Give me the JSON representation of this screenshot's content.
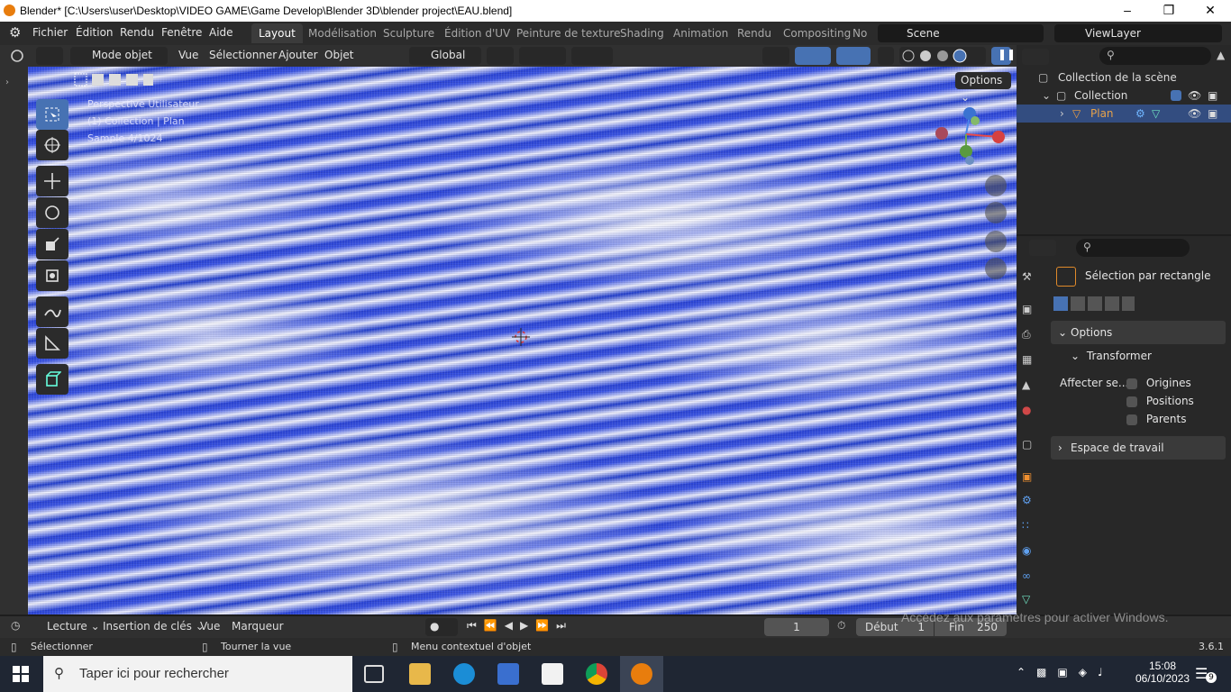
{
  "window": {
    "title": "Blender* [C:\\Users\\user\\Desktop\\VIDEO GAME\\Game Develop\\Blender 3D\\blender project\\EAU.blend]"
  },
  "menubar": {
    "menus": [
      "Fichier",
      "Édition",
      "Rendu",
      "Fenêtre",
      "Aide"
    ],
    "workspaces": [
      "Layout",
      "Modélisation",
      "Sculpture",
      "Édition d'UV",
      "Peinture de texture",
      "Shading",
      "Animation",
      "Rendu",
      "Compositing",
      "No"
    ],
    "active_workspace": "Layout",
    "scene": "Scene",
    "view_layer": "ViewLayer"
  },
  "viewport_header": {
    "mode": "Mode objet",
    "menus": [
      "Vue",
      "Sélectionner",
      "Ajouter",
      "Objet"
    ],
    "orientation": "Global",
    "options_button": "Options"
  },
  "viewport_overlay": {
    "line1": "Perspective Utilisateur",
    "line2": "(1) Collection | Plan",
    "line3": "Sample 4/1024"
  },
  "outliner": {
    "scene_collection": "Collection de la scène",
    "collection": "Collection",
    "object": "Plan"
  },
  "properties": {
    "tool_name": "Sélection par rectangle",
    "options_label": "Options",
    "transform_label": "Transformer",
    "affect_label": "Affecter se...",
    "checkboxes": [
      "Origines",
      "Positions",
      "Parents"
    ],
    "workspace_label": "Espace de travail"
  },
  "timeline": {
    "menus": [
      "Lecture",
      "Insertion de clés",
      "Vue",
      "Marqueur"
    ],
    "current_frame": "1",
    "start_label": "Début",
    "start_value": "1",
    "end_label": "Fin",
    "end_value": "250"
  },
  "statusbar": {
    "items": [
      "Sélectionner",
      "Tourner la vue",
      "Menu contextuel d'objet"
    ],
    "version": "3.6.1",
    "watermark_line1": "Accédez aux paramètres pour activer Windows."
  },
  "taskbar": {
    "search_placeholder": "Taper ici pour rechercher",
    "time": "15:08",
    "date": "06/10/2023",
    "notifications": "9"
  },
  "colors": {
    "accent": "#4772b3",
    "water_blue": "#2f4ad8",
    "blender_orange": "#e87d0d"
  }
}
